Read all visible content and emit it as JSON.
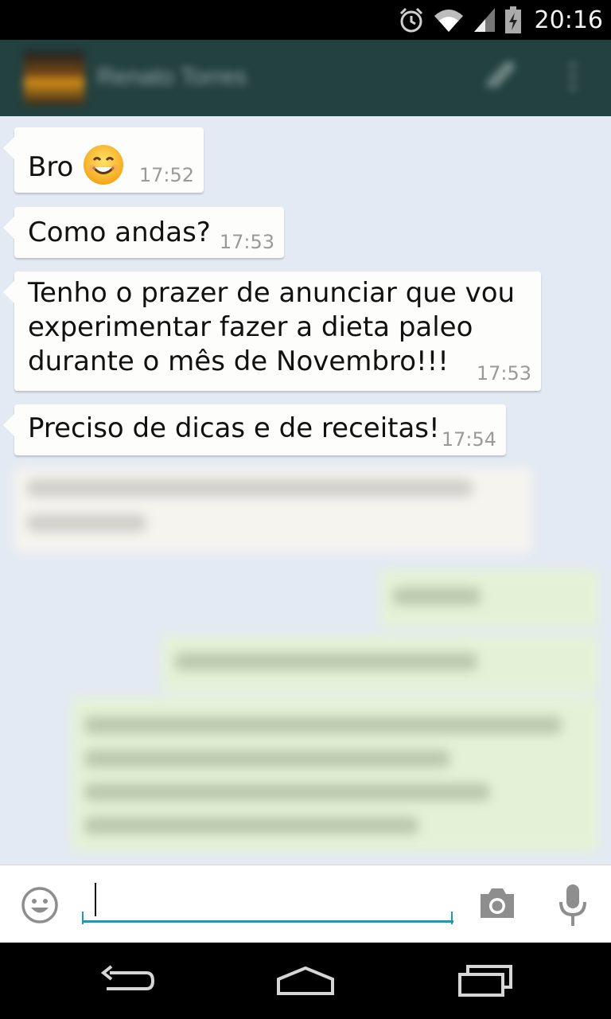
{
  "status_bar": {
    "time": "20:16",
    "icons": [
      "alarm-icon",
      "wifi-icon",
      "signal-icon",
      "battery-icon"
    ]
  },
  "header": {
    "contact_name": "Renato Torres",
    "icons": [
      "avatar",
      "paperclip-icon",
      "overflow-menu-icon"
    ]
  },
  "messages": [
    {
      "text": "Bro",
      "time": "17:52",
      "emoji": "smiling-face-emoji"
    },
    {
      "text": "Como andas?",
      "time": "17:53"
    },
    {
      "lines": [
        "Tenho o prazer de anunciar que vou",
        "experimentar fazer a dieta paleo",
        "durante o mês de Novembro!!!"
      ],
      "time": "17:53"
    },
    {
      "text": "Preciso de dicas e de receitas!",
      "time": "17:54"
    }
  ],
  "input": {
    "placeholder": "",
    "value": ""
  },
  "colors": {
    "status_bar": "#000000",
    "action_bar": "#23413f",
    "chat_background": "#e4eaf3",
    "incoming_bubble": "#fdfdfb",
    "outgoing_bubble": "#e3f2d6",
    "input_underline": "#1a9ab8"
  },
  "navigation": {
    "icons": [
      "back-icon",
      "home-icon",
      "recent-apps-icon"
    ]
  }
}
